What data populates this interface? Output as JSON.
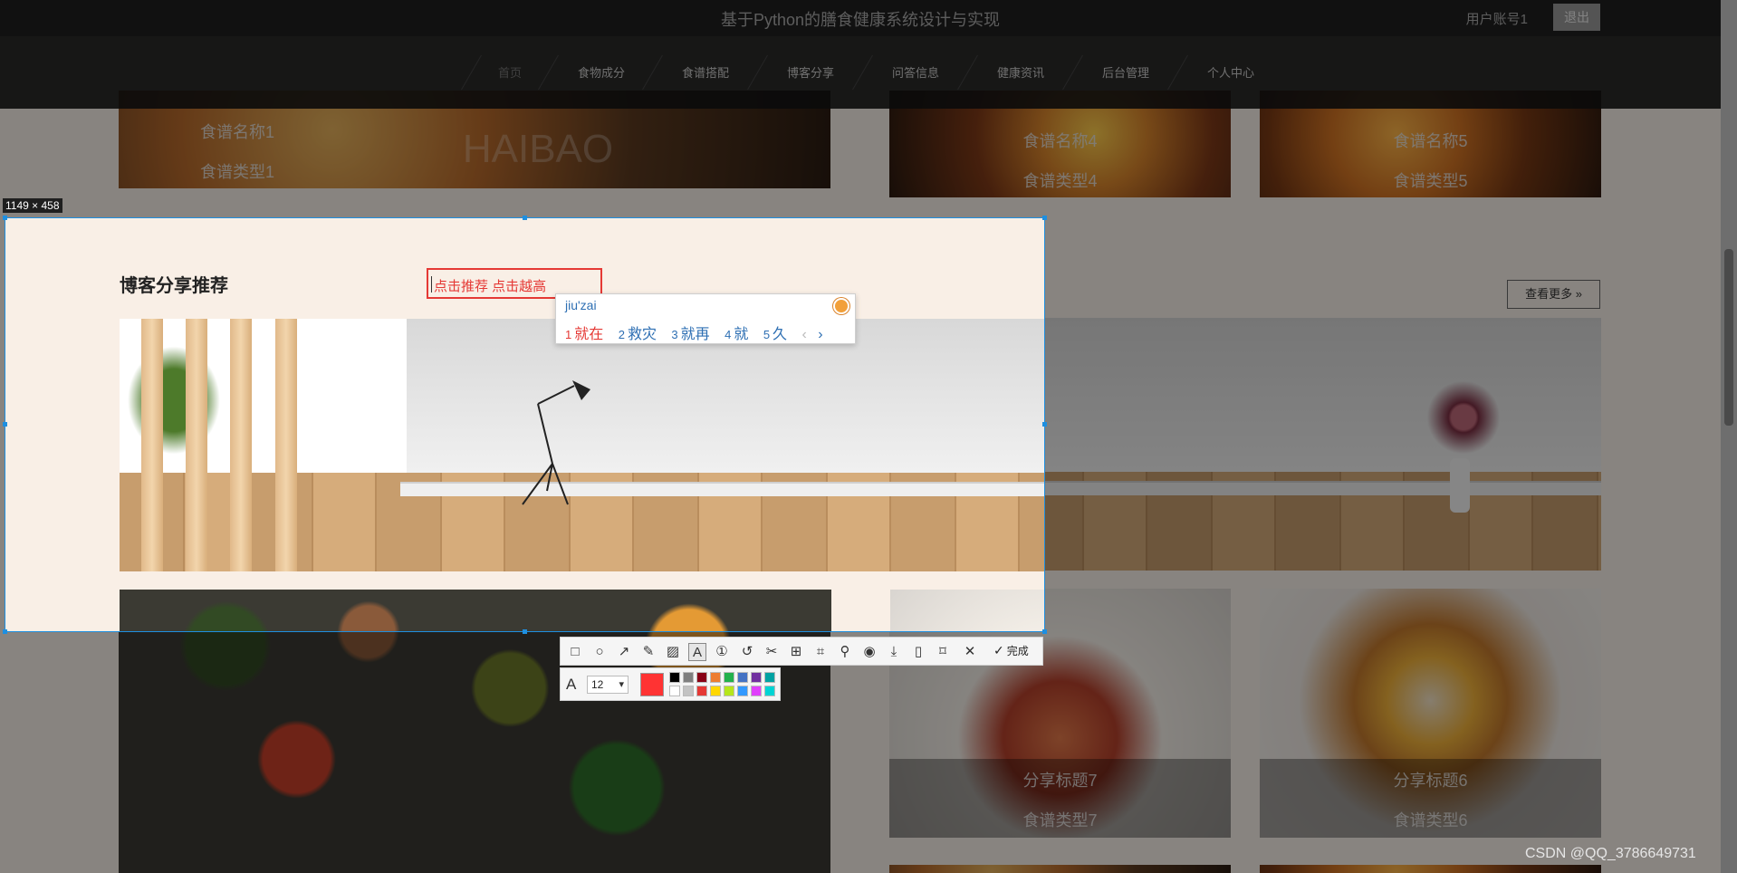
{
  "header": {
    "site_title": "基于Python的膳食健康系统设计与实现",
    "account": "用户账号1",
    "logout_label": "退出"
  },
  "nav": {
    "items": [
      {
        "label": "首页",
        "active": true
      },
      {
        "label": "食物成分"
      },
      {
        "label": "食谱搭配"
      },
      {
        "label": "博客分享"
      },
      {
        "label": "问答信息"
      },
      {
        "label": "健康资讯"
      },
      {
        "label": "后台管理"
      },
      {
        "label": "个人中心"
      }
    ]
  },
  "recipes": {
    "tile1": {
      "name": "食谱名称1",
      "type": "食谱类型1"
    },
    "tile4": {
      "name": "食谱名称4",
      "type": "食谱类型4"
    },
    "tile5": {
      "name": "食谱名称5",
      "type": "食谱类型5"
    },
    "watermark_logo": "HAIBAO"
  },
  "blog": {
    "section_title": "博客分享推荐",
    "more_label": "查看更多",
    "share7": {
      "title": "分享标题7",
      "type": "食谱类型7"
    },
    "share6": {
      "title": "分享标题6",
      "type": "食谱类型6"
    }
  },
  "capture": {
    "size_label": "1149 × 458",
    "text_content": "点击推荐 点击越高",
    "text_color": "#e53935",
    "font_size": "12",
    "current_color": "#ff3333",
    "done_label": "完成"
  },
  "ime": {
    "pinyin": "jiu'zai",
    "candidates": [
      {
        "n": "1",
        "text": "就在"
      },
      {
        "n": "2",
        "text": "救灾"
      },
      {
        "n": "3",
        "text": "就再"
      },
      {
        "n": "4",
        "text": "就"
      },
      {
        "n": "5",
        "text": "久"
      }
    ],
    "prev_arrow": "‹",
    "next_arrow": "›"
  },
  "palette": [
    "#000000",
    "#7f7f7f",
    "#880015",
    "#ed7d31",
    "#22b14c",
    "#4472c4",
    "#7030a0",
    "#00a2a2",
    "#ffffff",
    "#c3c3c3",
    "#e53935",
    "#ffd700",
    "#b5e61d",
    "#3399ff",
    "#e040fb",
    "#00d4d4"
  ],
  "footer_watermark": "CSDN @QQ_3786649731"
}
